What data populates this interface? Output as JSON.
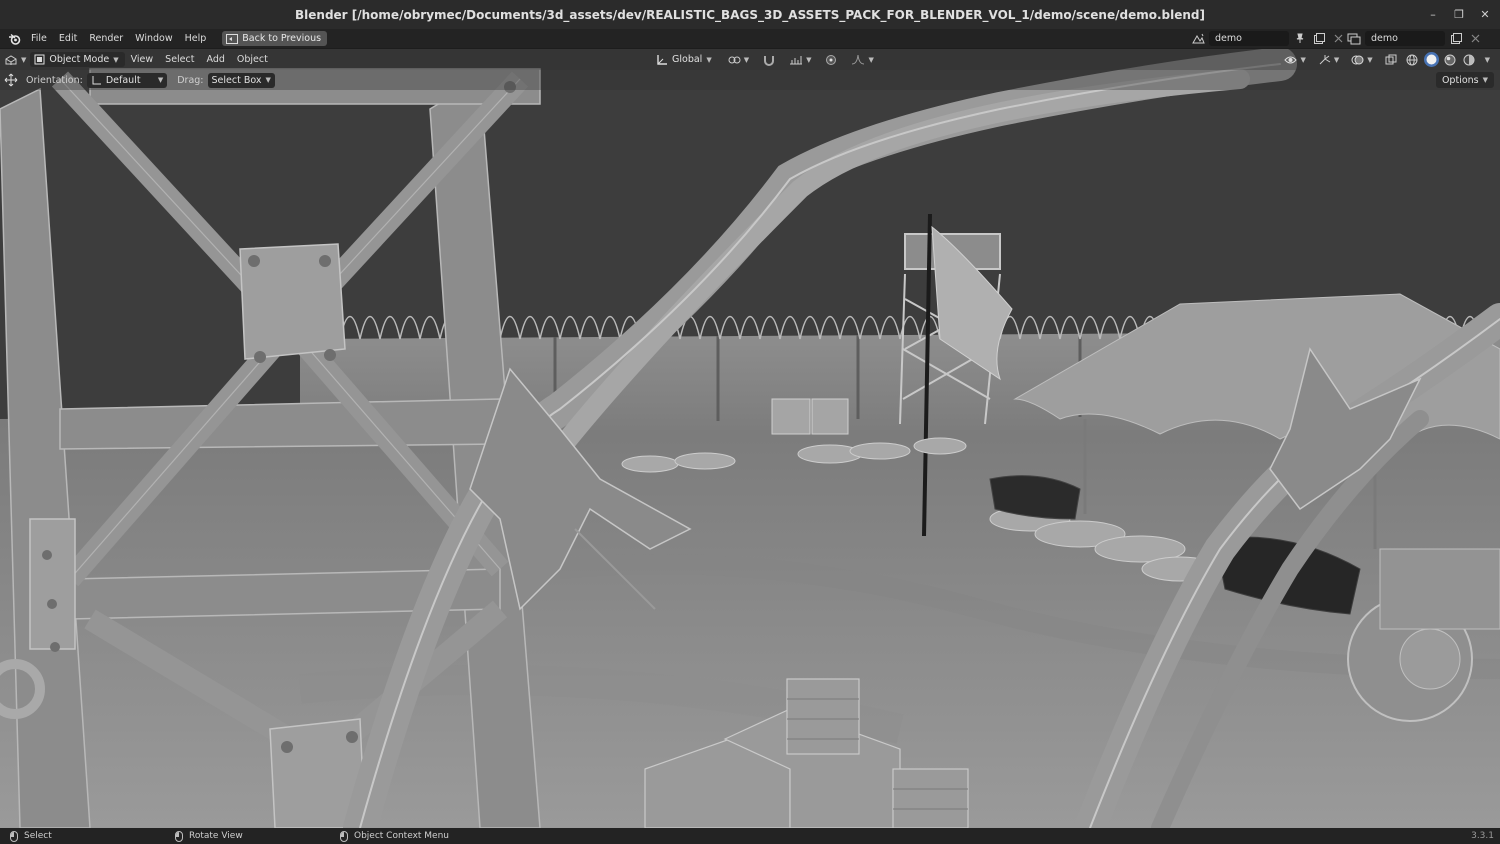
{
  "window": {
    "title": "Blender [/home/obrymec/Documents/3d_assets/dev/REALISTIC_BAGS_3D_ASSETS_PACK_FOR_BLENDER_VOL_1/demo/scene/demo.blend]",
    "controls": {
      "minimize": "–",
      "maximize": "❐",
      "close": "✕"
    }
  },
  "topbar": {
    "menus": [
      "File",
      "Edit",
      "Render",
      "Window",
      "Help"
    ],
    "back_label": "Back to Previous",
    "scene_name": "demo",
    "view_layer_name": "demo"
  },
  "viewport_header": {
    "mode": "Object Mode",
    "menus": [
      "View",
      "Select",
      "Add",
      "Object"
    ],
    "transform_orientation": "Global"
  },
  "tool_settings": {
    "orientation_label": "Orientation:",
    "orientation_value": "Default",
    "drag_label": "Drag:",
    "drag_value": "Select Box",
    "options_label": "Options"
  },
  "statusbar": {
    "items": [
      "Select",
      "Rotate View",
      "Object Context Menu"
    ],
    "version": "3.3.1"
  },
  "colors": {
    "background": "#3d3d3d",
    "topbar": "#232323",
    "solid_shading": "#8a8a8a"
  }
}
